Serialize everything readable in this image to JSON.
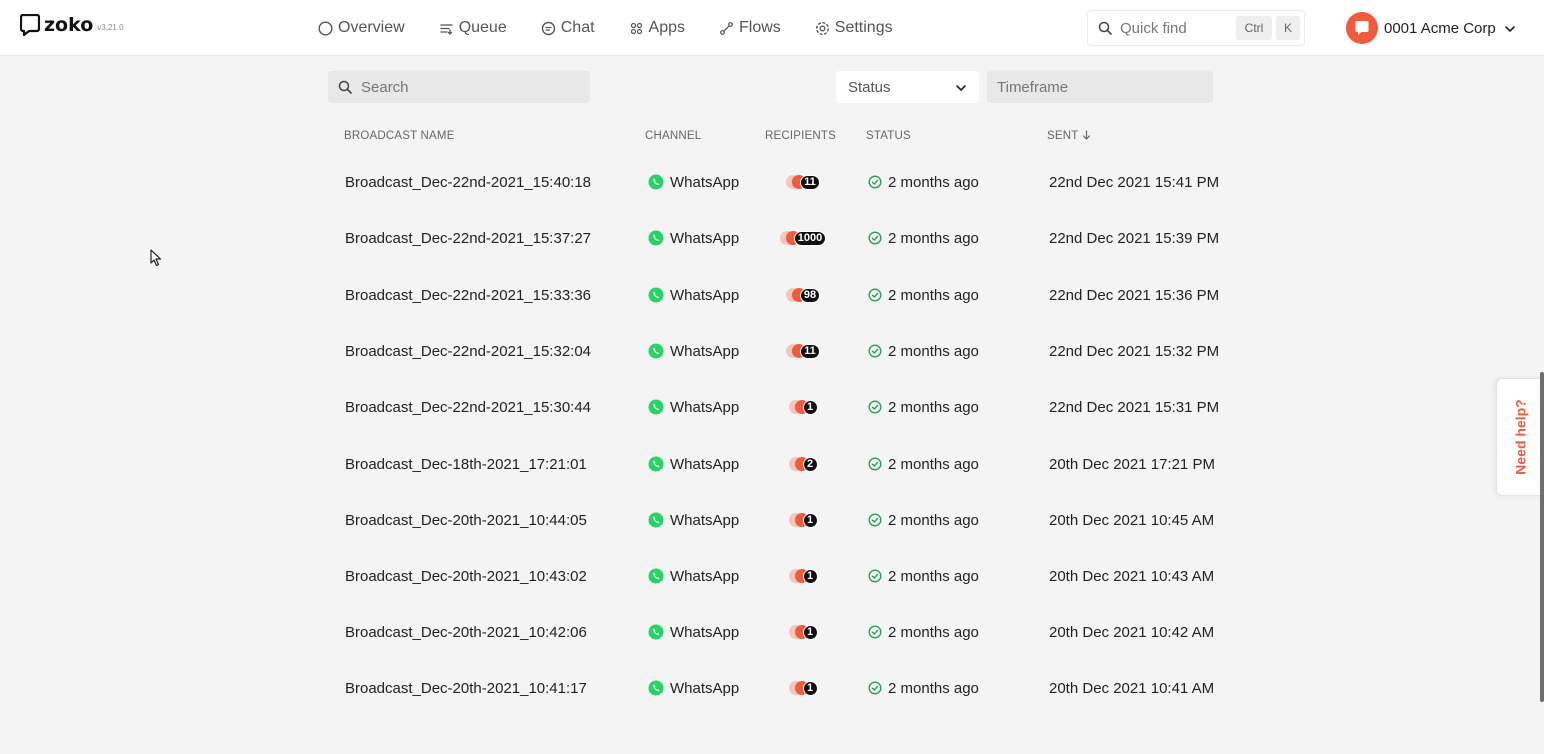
{
  "app": {
    "logo_text": "zoko",
    "version": "v3.21.0"
  },
  "nav": {
    "items": [
      {
        "label": "Overview",
        "icon": "circle-icon"
      },
      {
        "label": "Queue",
        "icon": "queue-icon"
      },
      {
        "label": "Chat",
        "icon": "chat-icon"
      },
      {
        "label": "Apps",
        "icon": "apps-icon"
      },
      {
        "label": "Flows",
        "icon": "flows-icon"
      },
      {
        "label": "Settings",
        "icon": "gear-icon"
      }
    ]
  },
  "quickfind": {
    "label": "Quick find",
    "key1": "Ctrl",
    "key2": "K"
  },
  "account": {
    "name": "0001 Acme Corp"
  },
  "filters": {
    "search_placeholder": "Search",
    "status_label": "Status",
    "timeframe_placeholder": "Timeframe"
  },
  "table": {
    "columns": {
      "name": "BROADCAST NAME",
      "channel": "CHANNEL",
      "recipients": "RECIPIENTS",
      "status": "STATUS",
      "sent": "SENT"
    },
    "rows": [
      {
        "name": "Broadcast_Dec-22nd-2021_15:40:18",
        "channel": "WhatsApp",
        "recipients": "11",
        "status": "2 months ago",
        "sent": "22nd Dec 2021 15:41 PM"
      },
      {
        "name": "Broadcast_Dec-22nd-2021_15:37:27",
        "channel": "WhatsApp",
        "recipients": "1000",
        "status": "2 months ago",
        "sent": "22nd Dec 2021 15:39 PM"
      },
      {
        "name": "Broadcast_Dec-22nd-2021_15:33:36",
        "channel": "WhatsApp",
        "recipients": "98",
        "status": "2 months ago",
        "sent": "22nd Dec 2021 15:36 PM"
      },
      {
        "name": "Broadcast_Dec-22nd-2021_15:32:04",
        "channel": "WhatsApp",
        "recipients": "11",
        "status": "2 months ago",
        "sent": "22nd Dec 2021 15:32 PM"
      },
      {
        "name": "Broadcast_Dec-22nd-2021_15:30:44",
        "channel": "WhatsApp",
        "recipients": "1",
        "status": "2 months ago",
        "sent": "22nd Dec 2021 15:31 PM"
      },
      {
        "name": "Broadcast_Dec-18th-2021_17:21:01",
        "channel": "WhatsApp",
        "recipients": "2",
        "status": "2 months ago",
        "sent": "20th Dec 2021 17:21 PM"
      },
      {
        "name": "Broadcast_Dec-20th-2021_10:44:05",
        "channel": "WhatsApp",
        "recipients": "1",
        "status": "2 months ago",
        "sent": "20th Dec 2021 10:45 AM"
      },
      {
        "name": "Broadcast_Dec-20th-2021_10:43:02",
        "channel": "WhatsApp",
        "recipients": "1",
        "status": "2 months ago",
        "sent": "20th Dec 2021 10:43 AM"
      },
      {
        "name": "Broadcast_Dec-20th-2021_10:42:06",
        "channel": "WhatsApp",
        "recipients": "1",
        "status": "2 months ago",
        "sent": "20th Dec 2021 10:42 AM"
      },
      {
        "name": "Broadcast_Dec-20th-2021_10:41:17",
        "channel": "WhatsApp",
        "recipients": "1",
        "status": "2 months ago",
        "sent": "20th Dec 2021 10:41 AM"
      }
    ]
  },
  "help": {
    "label": "Need help?"
  },
  "colors": {
    "accent": "#ef5b3c",
    "whatsapp": "#25d366",
    "status_ok": "#2e9d5b"
  }
}
